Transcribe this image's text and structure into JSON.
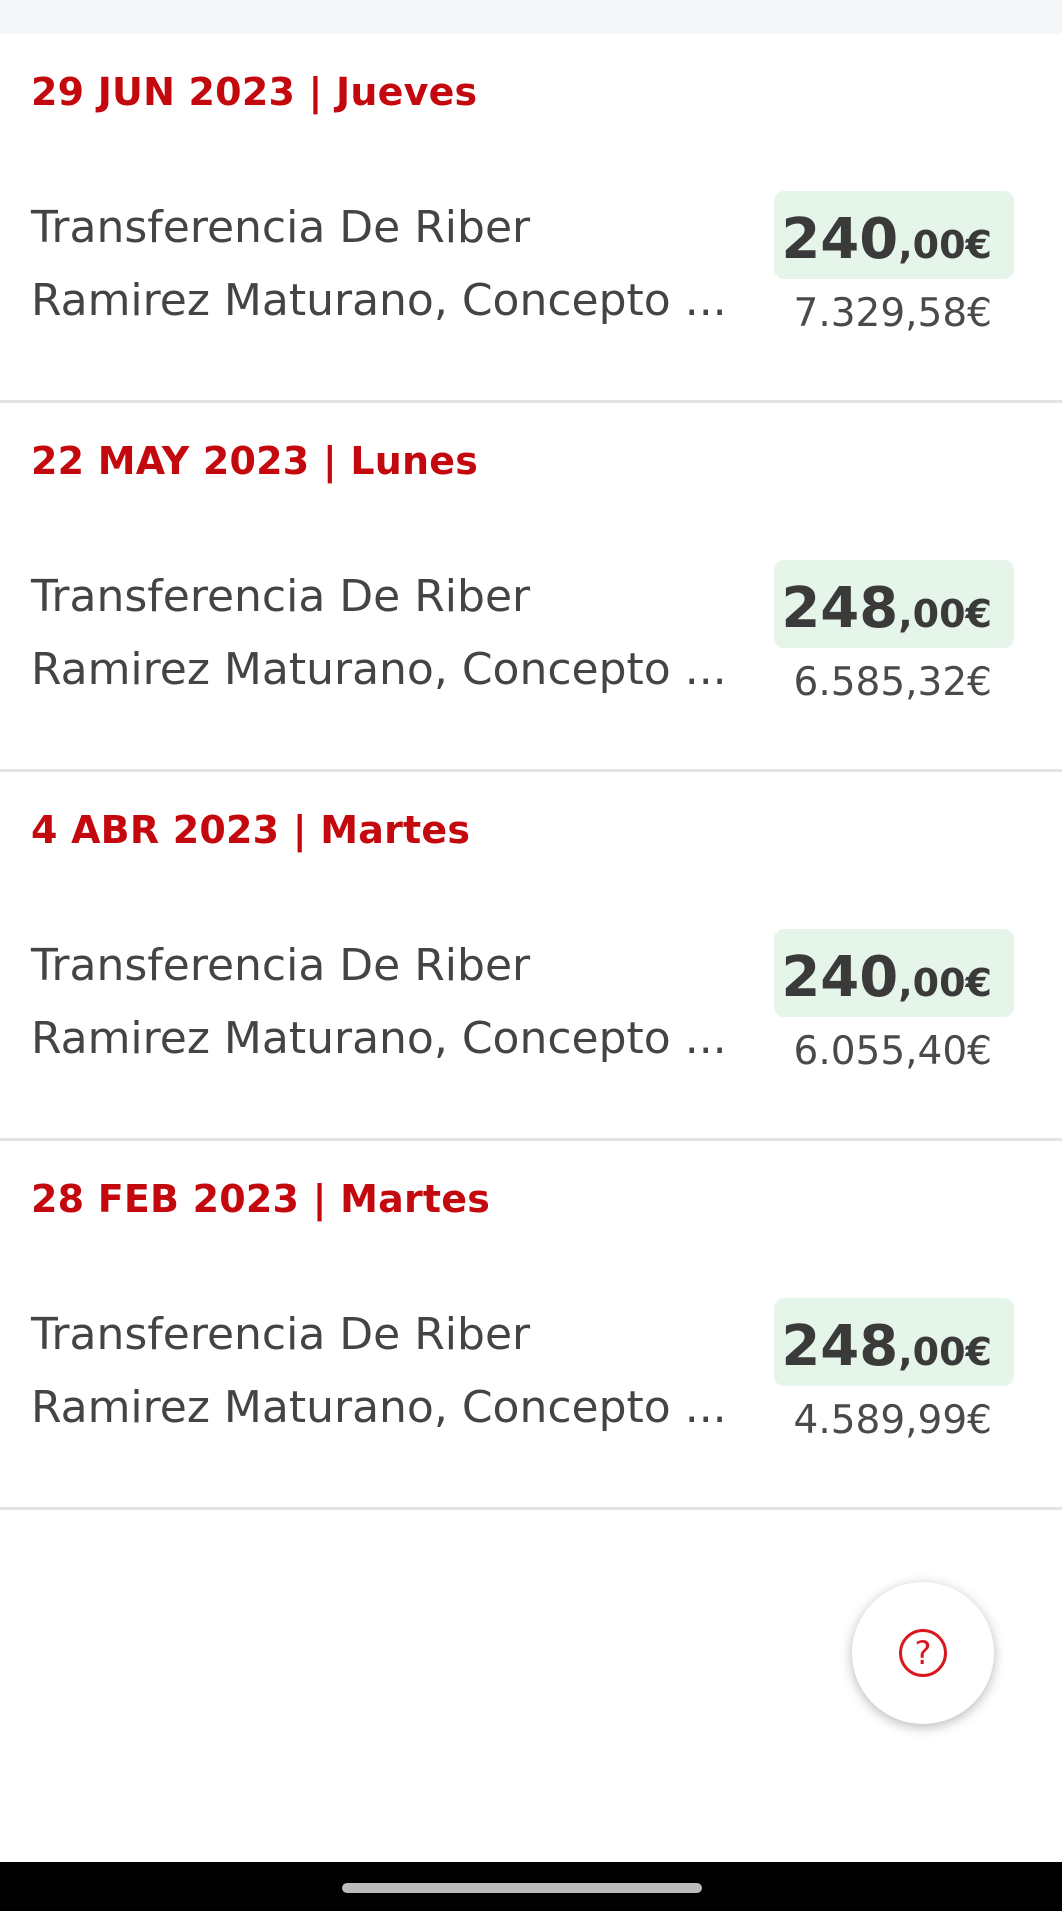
{
  "transactions": [
    {
      "date_label": "29 JUN 2023 | Jueves",
      "description_line1": "Transferencia De Riber",
      "description_line2": "Ramirez Maturano, Concepto ...",
      "amount_integer": "240",
      "amount_decimal": ",00€",
      "balance": "7.329,58€"
    },
    {
      "date_label": "22 MAY 2023 | Lunes",
      "description_line1": "Transferencia De Riber",
      "description_line2": "Ramirez Maturano, Concepto ...",
      "amount_integer": "248",
      "amount_decimal": ",00€",
      "balance": "6.585,32€"
    },
    {
      "date_label": "4 ABR 2023 | Martes",
      "description_line1": "Transferencia De Riber",
      "description_line2": "Ramirez Maturano, Concepto ...",
      "amount_integer": "240",
      "amount_decimal": ",00€",
      "balance": "6.055,40€"
    },
    {
      "date_label": "28 FEB 2023 | Martes",
      "description_line1": "Transferencia De Riber",
      "description_line2": "Ramirez Maturano, Concepto ...",
      "amount_integer": "248",
      "amount_decimal": ",00€",
      "balance": "4.589,99€"
    }
  ],
  "help_button": {
    "icon": "question-circle-icon",
    "glyph": "?"
  },
  "colors": {
    "accent_red": "#c4090e",
    "income_badge_bg": "#e6f5e9"
  }
}
